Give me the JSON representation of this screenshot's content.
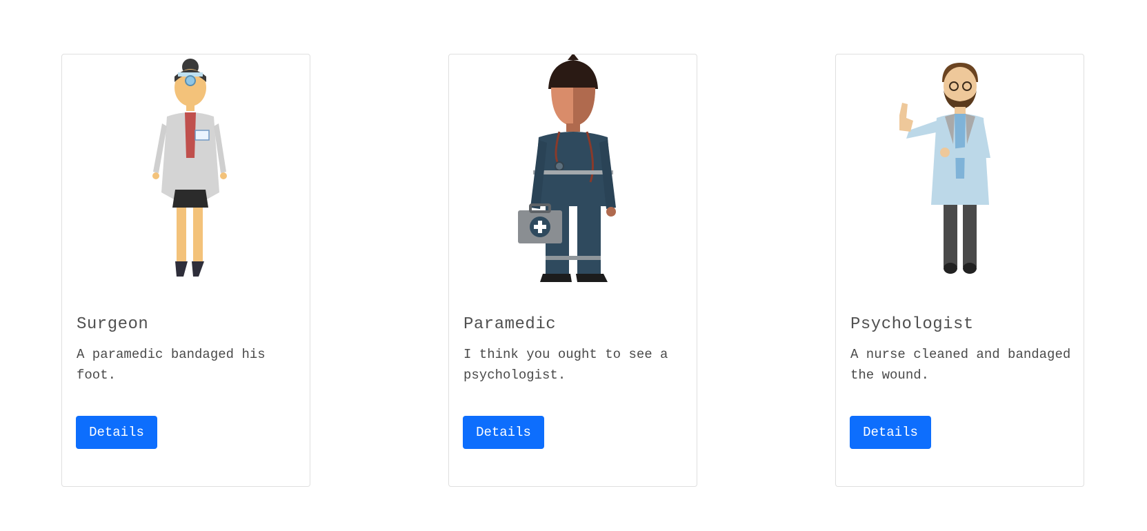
{
  "cards": [
    {
      "title": "Surgeon",
      "text": "A paramedic bandaged his foot.",
      "button_label": "Details",
      "image_icon": "female-doctor-illustration"
    },
    {
      "title": "Paramedic",
      "text": "I think you ought to see a psychologist.",
      "button_label": "Details",
      "image_icon": "paramedic-illustration"
    },
    {
      "title": "Psychologist",
      "text": "A nurse cleaned and bandaged the wound.",
      "button_label": "Details",
      "image_icon": "male-doctor-illustration"
    }
  ],
  "colors": {
    "button_bg": "#0d6efd",
    "button_text": "#ffffff",
    "card_border": "#dfdfdf"
  }
}
